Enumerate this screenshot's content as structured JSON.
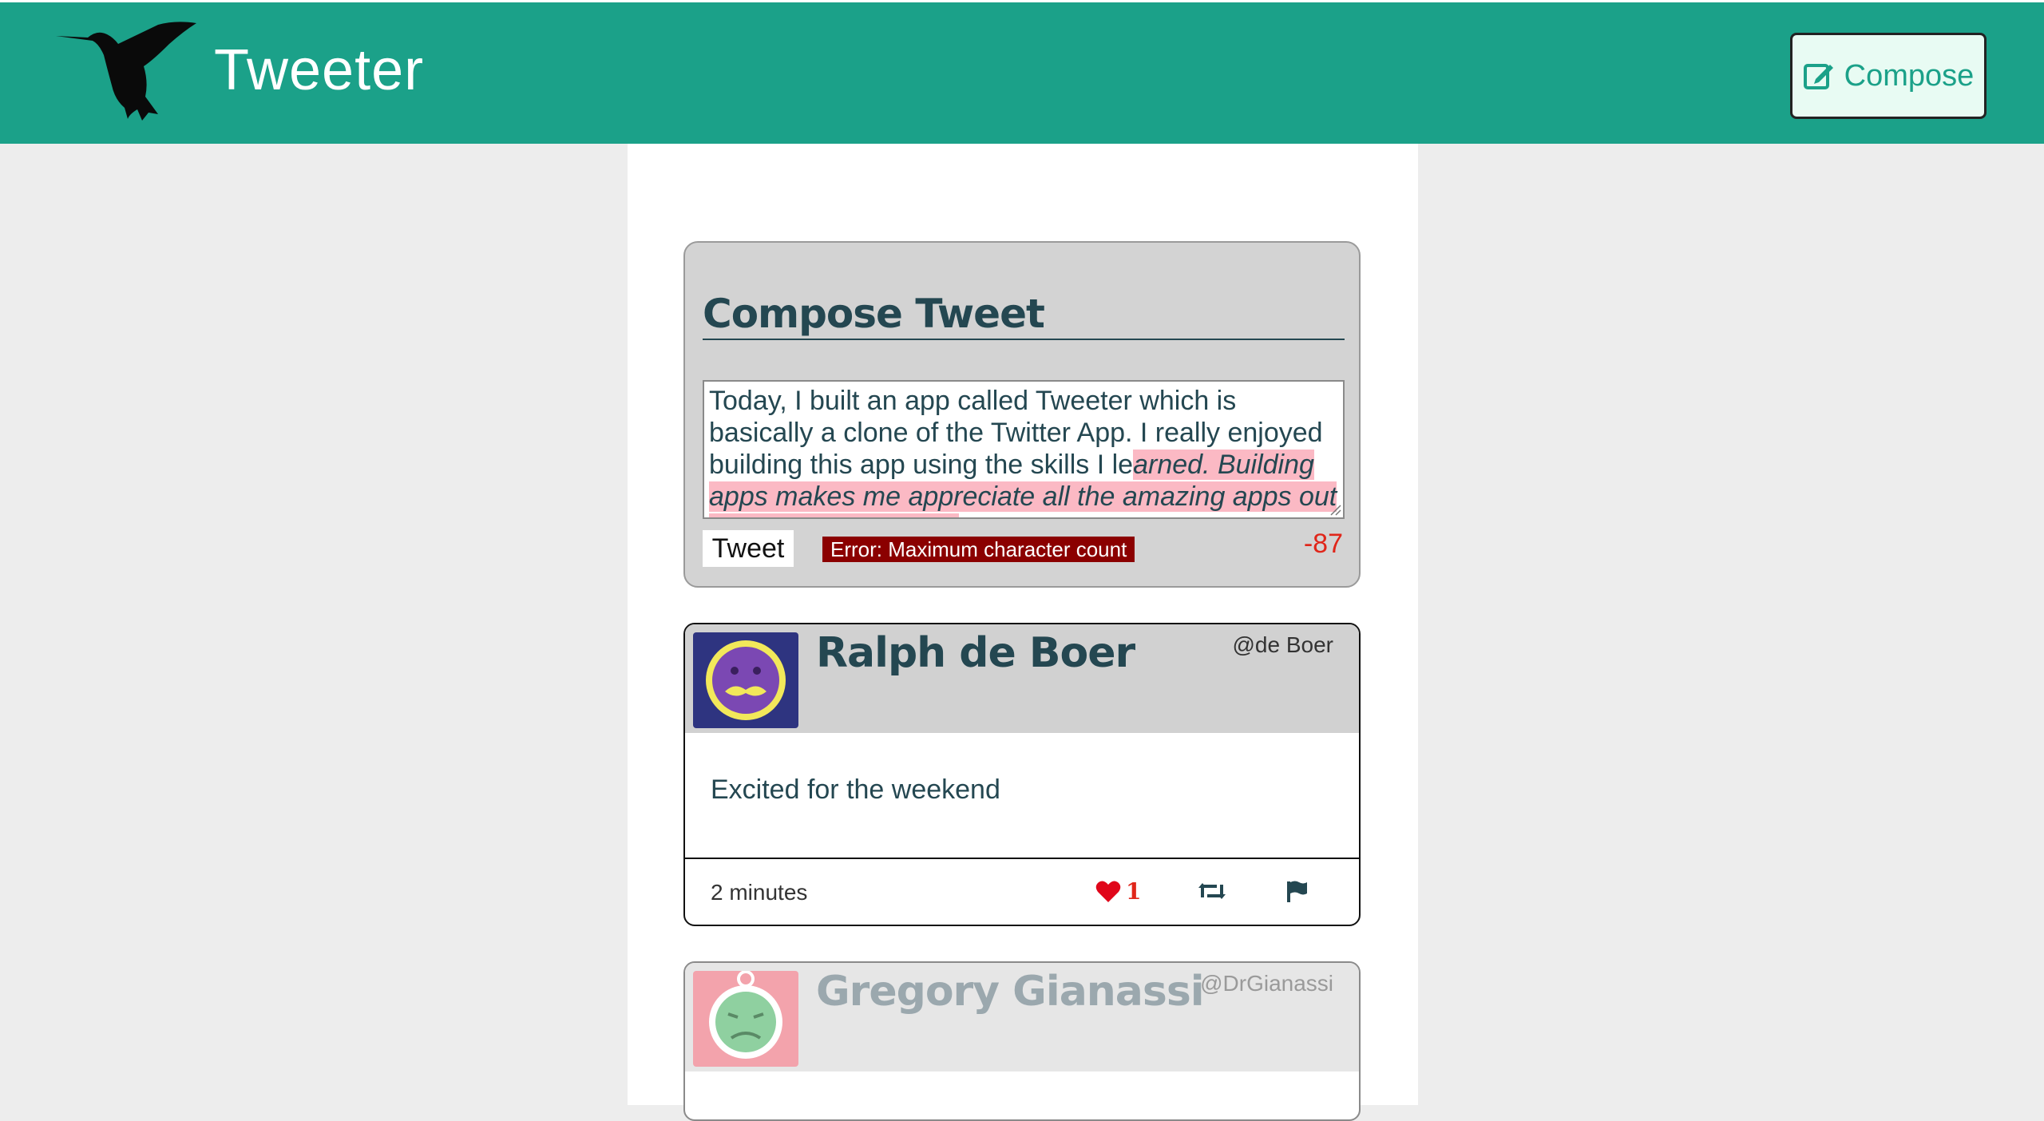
{
  "nav": {
    "brand": "Tweeter",
    "compose_label": "Compose",
    "brand_color": "#1ba189"
  },
  "composer": {
    "title": "Compose Tweet",
    "text_within_limit": "Today, I built an app called Tweeter which is basically a clone of the Twitter App. I really enjoyed building this app using the skills I le",
    "text_over_limit": "arned. Building apps makes me appreciate all the amazing apps out there such as Twitter",
    "tweet_button": "Tweet",
    "error_message": "Error: Maximum character count",
    "counter": "-87"
  },
  "tweets": [
    {
      "name": "Ralph de Boer",
      "handle": "@de Boer",
      "text": "Excited for the weekend",
      "time": "2 minutes",
      "likes": "1",
      "avatar_icon": "purple-mustache-face-avatar"
    },
    {
      "name": "Gregory Gianassi",
      "handle": "@DrGianassi",
      "avatar_icon": "green-face-avatar"
    }
  ]
}
